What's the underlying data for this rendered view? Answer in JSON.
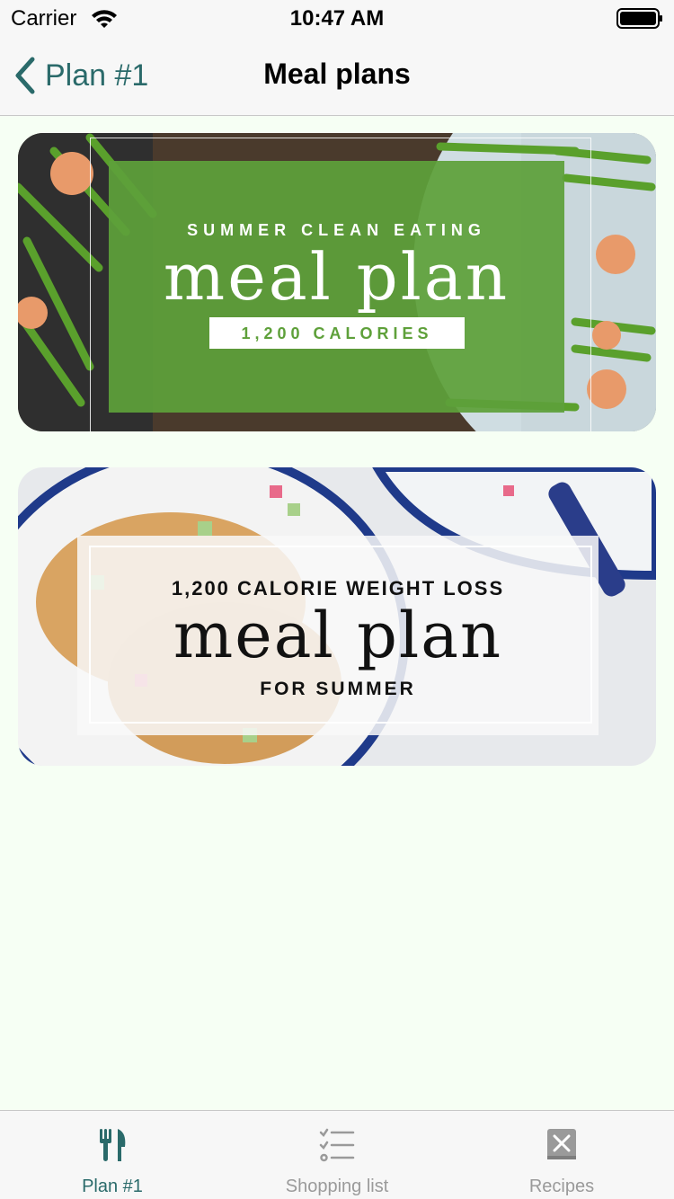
{
  "status_bar": {
    "carrier": "Carrier",
    "time": "10:47 AM"
  },
  "nav": {
    "back_label": "Plan #1",
    "title": "Meal plans"
  },
  "cards": [
    {
      "subtitle": "SUMMER CLEAN EATING",
      "title": "meal plan",
      "badge": "1,200 CALORIES",
      "accent": "#5ea03a"
    },
    {
      "subtitle": "1,200 CALORIE WEIGHT LOSS",
      "title": "meal plan",
      "bottom": "FOR SUMMER"
    }
  ],
  "tabs": [
    {
      "label": "Plan #1",
      "icon": "fork-knife-icon",
      "active": true
    },
    {
      "label": "Shopping list",
      "icon": "checklist-icon",
      "active": false
    },
    {
      "label": "Recipes",
      "icon": "recipe-book-icon",
      "active": false
    }
  ],
  "colors": {
    "tint": "#2a6a6a",
    "inactive": "#9a9a9a",
    "background": "#f6fff4"
  }
}
